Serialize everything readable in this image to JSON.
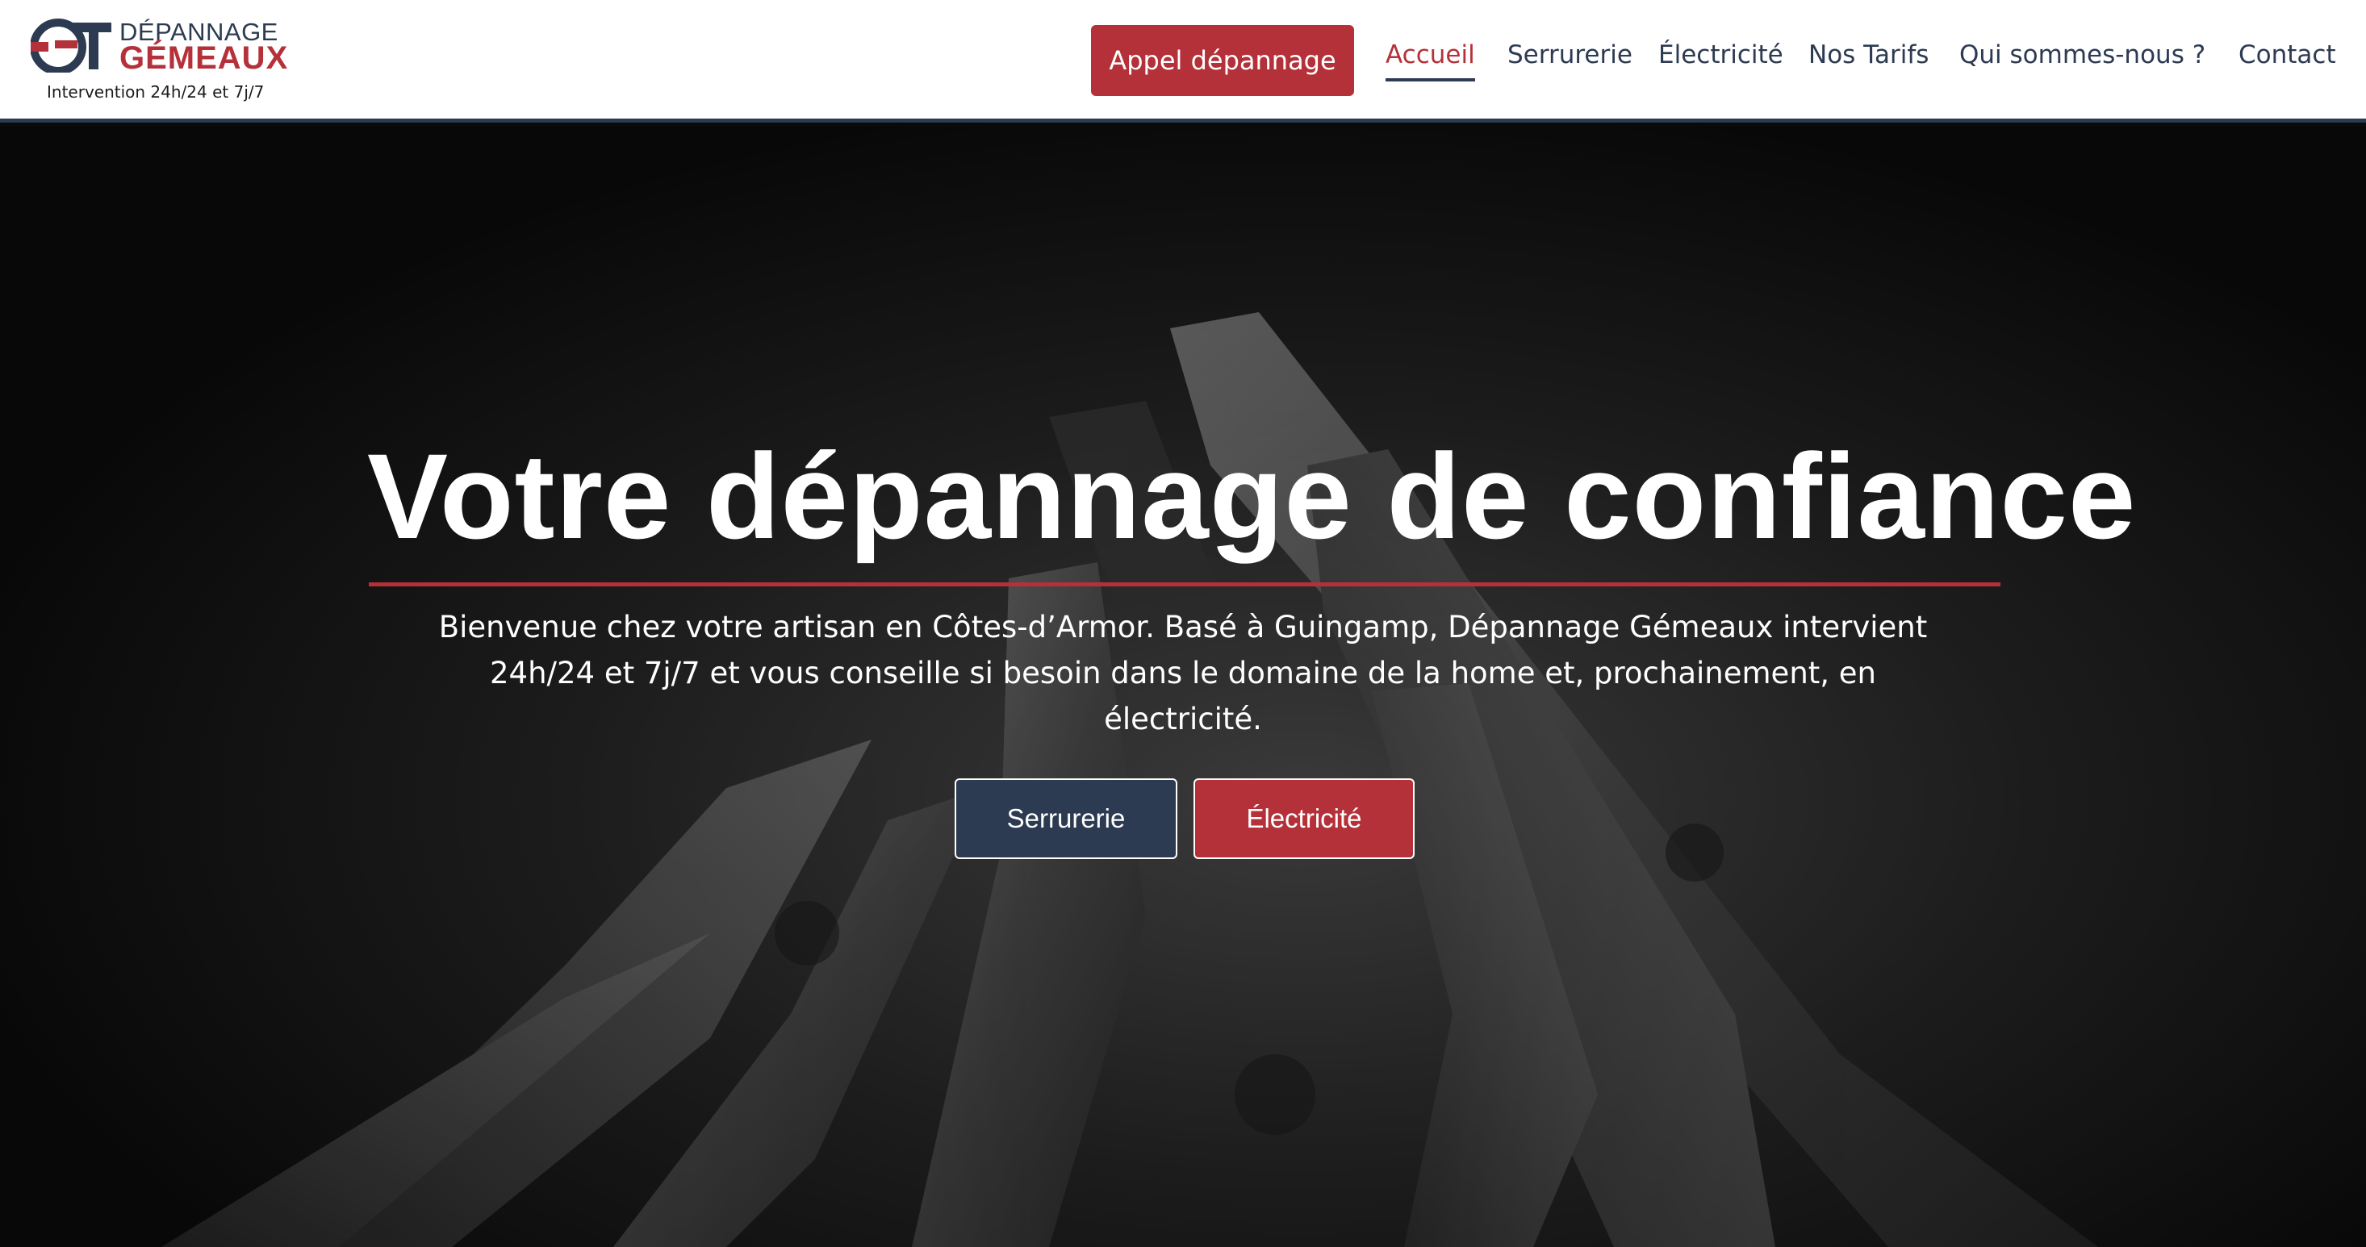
{
  "brand": {
    "line1": "DÉPANNAGE",
    "line2": "GÉMEAUX",
    "tagline": "Intervention 24h/24 et 7j/7",
    "colors": {
      "primary": "#2c3a52",
      "accent": "#b5313a"
    }
  },
  "header": {
    "cta_label": "Appel dépannage",
    "nav": [
      {
        "label": "Accueil",
        "active": true
      },
      {
        "label": "Serrurerie"
      },
      {
        "label": "Électricité"
      },
      {
        "label": "Nos Tarifs"
      },
      {
        "label": "Qui sommes-nous ?"
      },
      {
        "label": "Contact"
      }
    ]
  },
  "hero": {
    "title": "Votre dépannage de confiance",
    "description": "Bienvenue chez votre artisan en Côtes-d’Armor. Basé à Guingamp, Dépannage Gémeaux intervient 24h/24 et 7j/7 et vous conseille si besoin dans le domaine de la home et, prochainement, en électricité.",
    "buttons": [
      {
        "label": "Serrurerie"
      },
      {
        "label": "Électricité"
      }
    ],
    "background_icon": "keys-photo"
  }
}
